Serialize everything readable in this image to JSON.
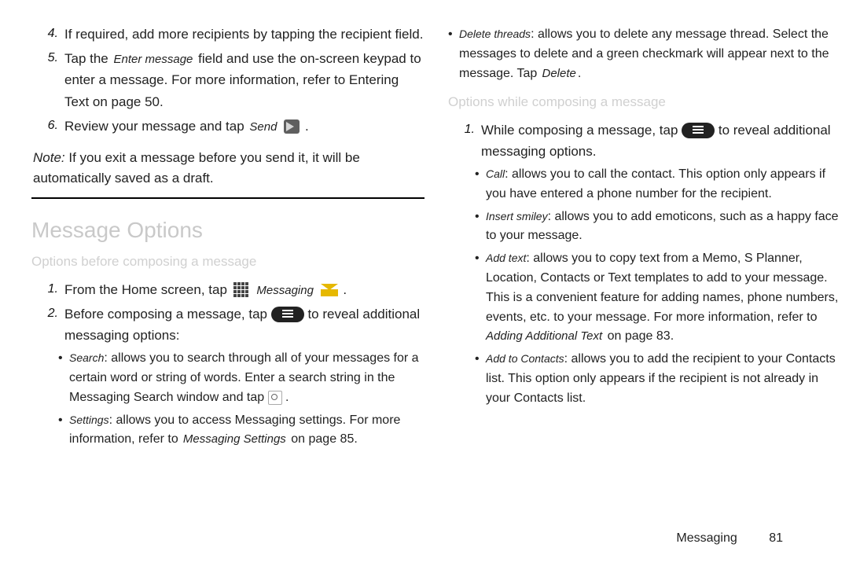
{
  "left": {
    "step4": {
      "num": "4.",
      "a": "If required, add more re",
      "b": "cipi",
      "c": "ents by tapping the recipient field."
    },
    "step5": {
      "num": "5.",
      "a": "Tap the",
      "term": "Enter message",
      "b": " field and use the on-screen keypad to enter a message. For more information, refer to",
      "c": " Entering Text",
      "d": " on page 50."
    },
    "step6": {
      "num": "6.",
      "a": "Review your message and",
      "b": " tap",
      "c": "Send",
      "d": " ."
    },
    "note": {
      "label": "Note:",
      "text": " If you exit a message before you send it, it will be automatically saved as a draft."
    },
    "sectionTitle": "Message Options",
    "subTitle": "Options before composing a message",
    "step1b": {
      "num": "1.",
      "a": "From the Home screen",
      "b": ", tap",
      "term": "Messaging",
      "c": " ."
    },
    "step2b": {
      "num": "2.",
      "a": "Before composing a message,",
      "b": " tap",
      "c": " to reveal additional messaging options:"
    },
    "bullets": {
      "search": {
        "term": "Search",
        "text": ": allows you to search through all of your messages for a certain word or string of words. Enter a search string in the Messaging Search window a",
        "mid": "nd tap",
        "end": " ."
      },
      "settings": {
        "term": "Settings",
        "text": ": allows you to access Messaging settings. For more information, refer",
        "mid": " to",
        "em": " Messaging Settings",
        "end": " on page 85."
      }
    }
  },
  "right": {
    "delthreads": {
      "term": "Delete threads",
      "a": ": allows you to delete any message thread. Select the messages to delete and a green checkmark will appear next to the message",
      "b": ". Tap",
      "c": " Delete",
      "d": "."
    },
    "subTitle": "Options while composing a message",
    "step1": {
      "num": "1.",
      "a": "While composing a message,",
      "b": " tap",
      "c": " to reveal additional messaging options."
    },
    "bullets": {
      "call": {
        "term": "Call",
        "text": ": allows you to call the contact. This option only appears if you have entered a phone number for the recipient."
      },
      "smiley": {
        "term": "Insert smiley",
        "text": ": allows you to add emoticons, such as a happy face to your message."
      },
      "addtext": {
        "term": "Add text",
        "a": ": allows you to copy text from a Memo, S Planner, Location, Contacts or Text templates to add to your message. This is a convenient feature for adding names, phone numbers, events, etc. to your me",
        "b": "ssage. ",
        "c": "For more information, refer",
        "d": " to",
        "e": " Adding Additional Text",
        "f": " on page 83."
      },
      "addcontacts": {
        "term": "Add to Contacts",
        "text": ": allows you to add the recipient to your Contacts list. This option only appears if the recipient is not already in your Contacts list."
      }
    }
  },
  "footer": {
    "section": "Messaging",
    "page": "81"
  }
}
